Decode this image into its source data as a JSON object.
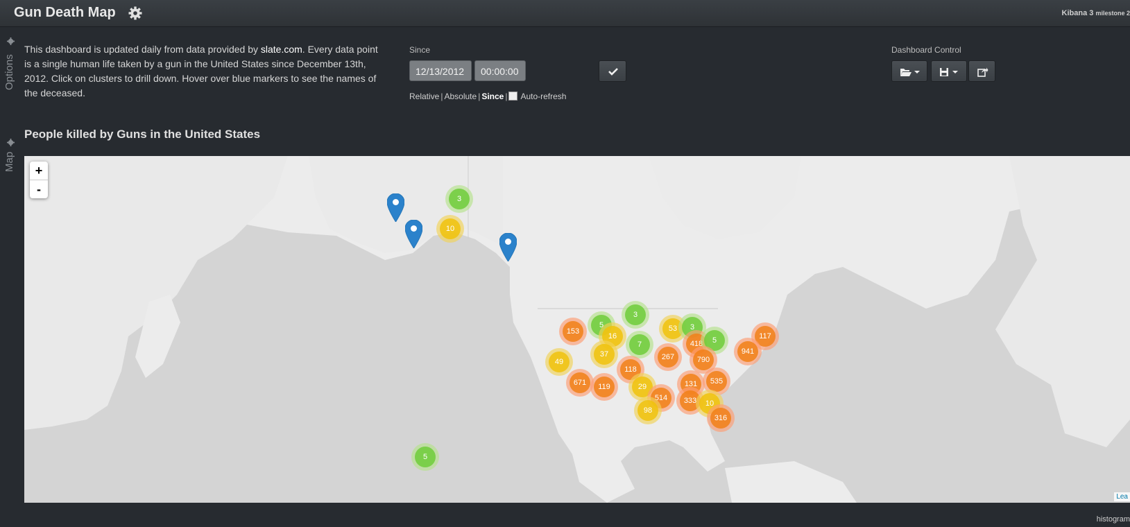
{
  "header": {
    "title": "Gun Death Map",
    "kibana": "Kibana 3",
    "milestone": "milestone 2"
  },
  "side_tabs": {
    "options": "Options",
    "map": "Map"
  },
  "description": {
    "before_link": "This dashboard is updated daily from data provided by ",
    "link": "slate.com",
    "after_link": ". Every data point is a single human life taken by a gun in the United States since December 13th, 2012. Click on clusters to drill down. Hover over blue markers to see the names of the deceased."
  },
  "timepicker": {
    "label": "Since",
    "date": "12/13/2012",
    "time": "00:00:00",
    "modes": [
      "Relative",
      "Absolute",
      "Since"
    ],
    "active_mode": "Since",
    "auto_refresh_label": "Auto-refresh",
    "auto_refresh_checked": false
  },
  "dashboard_control": {
    "label": "Dashboard Control",
    "buttons": [
      "open-folder-icon",
      "save-icon",
      "share-icon"
    ]
  },
  "map_panel": {
    "title": "People killed by Guns in the United States",
    "zoom_in": "+",
    "zoom_out": "-",
    "attribution": "Lea",
    "clusters": [
      {
        "count": "3",
        "level": "green"
      },
      {
        "count": "10",
        "level": "yellow"
      },
      {
        "count": "3",
        "level": "green"
      },
      {
        "count": "5",
        "level": "green"
      },
      {
        "count": "153",
        "level": "orange"
      },
      {
        "count": "16",
        "level": "yellow"
      },
      {
        "count": "53",
        "level": "yellow"
      },
      {
        "count": "3",
        "level": "green"
      },
      {
        "count": "7",
        "level": "green"
      },
      {
        "count": "418",
        "level": "orange"
      },
      {
        "count": "5",
        "level": "green"
      },
      {
        "count": "117",
        "level": "orange"
      },
      {
        "count": "37",
        "level": "yellow"
      },
      {
        "count": "267",
        "level": "orange"
      },
      {
        "count": "941",
        "level": "orange"
      },
      {
        "count": "49",
        "level": "yellow"
      },
      {
        "count": "790",
        "level": "orange"
      },
      {
        "count": "118",
        "level": "orange"
      },
      {
        "count": "671",
        "level": "orange"
      },
      {
        "count": "119",
        "level": "orange"
      },
      {
        "count": "29",
        "level": "yellow"
      },
      {
        "count": "131",
        "level": "orange"
      },
      {
        "count": "535",
        "level": "orange"
      },
      {
        "count": "514",
        "level": "orange"
      },
      {
        "count": "333",
        "level": "orange"
      },
      {
        "count": "10",
        "level": "yellow"
      },
      {
        "count": "98",
        "level": "yellow"
      },
      {
        "count": "316",
        "level": "orange"
      },
      {
        "count": "5",
        "level": "green"
      }
    ],
    "markers": 3
  },
  "footer": {
    "histogram": "histogram"
  }
}
